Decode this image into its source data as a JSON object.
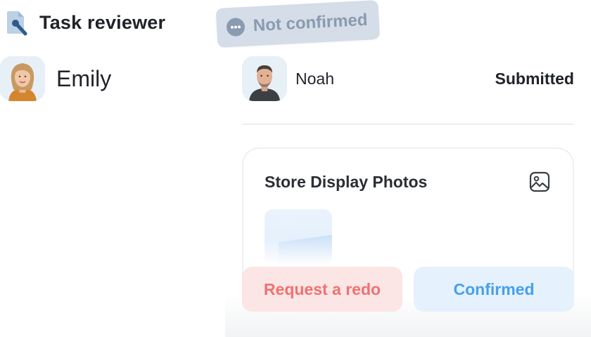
{
  "app": {
    "title": "Task reviewer",
    "icon": "task-reviewer-icon"
  },
  "reviewer": {
    "name": "Emily",
    "avatar": "avatar-photo"
  },
  "status_chip": {
    "label": "Not confirmed",
    "icon": "ellipsis-icon"
  },
  "submission": {
    "submitter_name": "Noah",
    "submitter_avatar": "avatar-photo",
    "status": "Submitted"
  },
  "task": {
    "title": "Store Display Photos",
    "icon": "image-icon"
  },
  "actions": {
    "redo_label": "Request a redo",
    "confirm_label": "Confirmed"
  },
  "colors": {
    "chip_bg": "#d4dde8",
    "chip_text": "#8a9ab0",
    "redo_bg": "#fbe5e5",
    "redo_text": "#f07171",
    "confirm_bg": "#e5f1fc",
    "confirm_text": "#46a0ec"
  }
}
